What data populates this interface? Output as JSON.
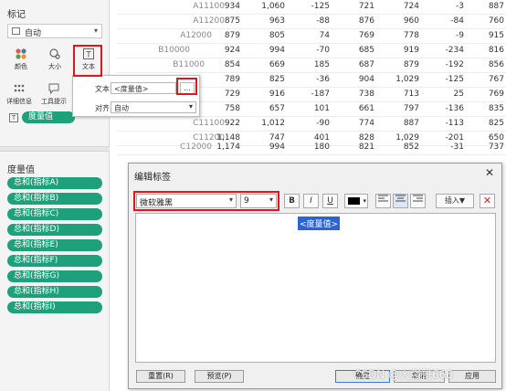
{
  "marks": {
    "title": "标记",
    "type_select": "自动",
    "buttons": [
      {
        "label": "颜色",
        "icon": "color-icon"
      },
      {
        "label": "大小",
        "icon": "size-icon"
      },
      {
        "label": "文本",
        "icon": "text-icon"
      },
      {
        "label": "详细信息",
        "icon": "detail-icon"
      },
      {
        "label": "工具提示",
        "icon": "tooltip-icon"
      }
    ],
    "text_pill": "度量值"
  },
  "text_popup": {
    "text_label": "文本:",
    "text_value": "<度量值>",
    "ellipsis": "...",
    "align_label": "对齐:",
    "align_value": "自动"
  },
  "measure_values": {
    "title": "度量值",
    "pills": [
      "总和(指标A)",
      "总和(指标B)",
      "总和(指标C)",
      "总和(指标D)",
      "总和(指标E)",
      "总和(指标F)",
      "总和(指标G)",
      "总和(指标H)",
      "总和(指标I)"
    ]
  },
  "table": {
    "rows": [
      {
        "label": "A11100",
        "values": [
          "934",
          "1,060",
          "-125",
          "721",
          "724",
          "-3",
          "887"
        ]
      },
      {
        "label": "A11200",
        "values": [
          "875",
          "963",
          "-88",
          "876",
          "960",
          "-84",
          "760"
        ]
      },
      {
        "label": "A12000",
        "values": [
          "879",
          "805",
          "74",
          "769",
          "778",
          "-9",
          "915"
        ]
      },
      {
        "label": "B10000",
        "values": [
          "924",
          "994",
          "-70",
          "685",
          "919",
          "-234",
          "816"
        ]
      },
      {
        "label": "B11000",
        "values": [
          "854",
          "669",
          "185",
          "687",
          "879",
          "-192",
          "856"
        ]
      },
      {
        "label": "",
        "values": [
          "789",
          "825",
          "-36",
          "904",
          "1,029",
          "-125",
          "767"
        ]
      },
      {
        "label": "",
        "values": [
          "729",
          "916",
          "-187",
          "738",
          "713",
          "25",
          "769"
        ]
      },
      {
        "label": "",
        "values": [
          "758",
          "657",
          "101",
          "661",
          "797",
          "-136",
          "835"
        ]
      },
      {
        "label": "C11100",
        "values": [
          "922",
          "1,012",
          "-90",
          "774",
          "887",
          "-113",
          "825"
        ]
      },
      {
        "label": "C11200",
        "values": [
          "1,148",
          "747",
          "401",
          "828",
          "1,029",
          "-201",
          "650"
        ]
      },
      {
        "label": "C12000",
        "values": [
          "1,174",
          "994",
          "180",
          "821",
          "852",
          "-31",
          "737"
        ]
      }
    ]
  },
  "dialog": {
    "title": "编辑标签",
    "font_name": "微软雅黑",
    "font_size": "9",
    "bold": "B",
    "italic": "I",
    "underline": "U",
    "insert_label": "插入▼",
    "token": "<度量值>",
    "reset_button": "重置(R)",
    "preview_button": "预览(P)",
    "ok_button": "确定",
    "cancel_button": "取消",
    "apply_button": "应用"
  },
  "watermark": "CSDN @大强哥666",
  "colors": {
    "pill_green": "#1ea17a",
    "highlight_red": "#e0161c",
    "token_blue": "#2b64d4"
  }
}
